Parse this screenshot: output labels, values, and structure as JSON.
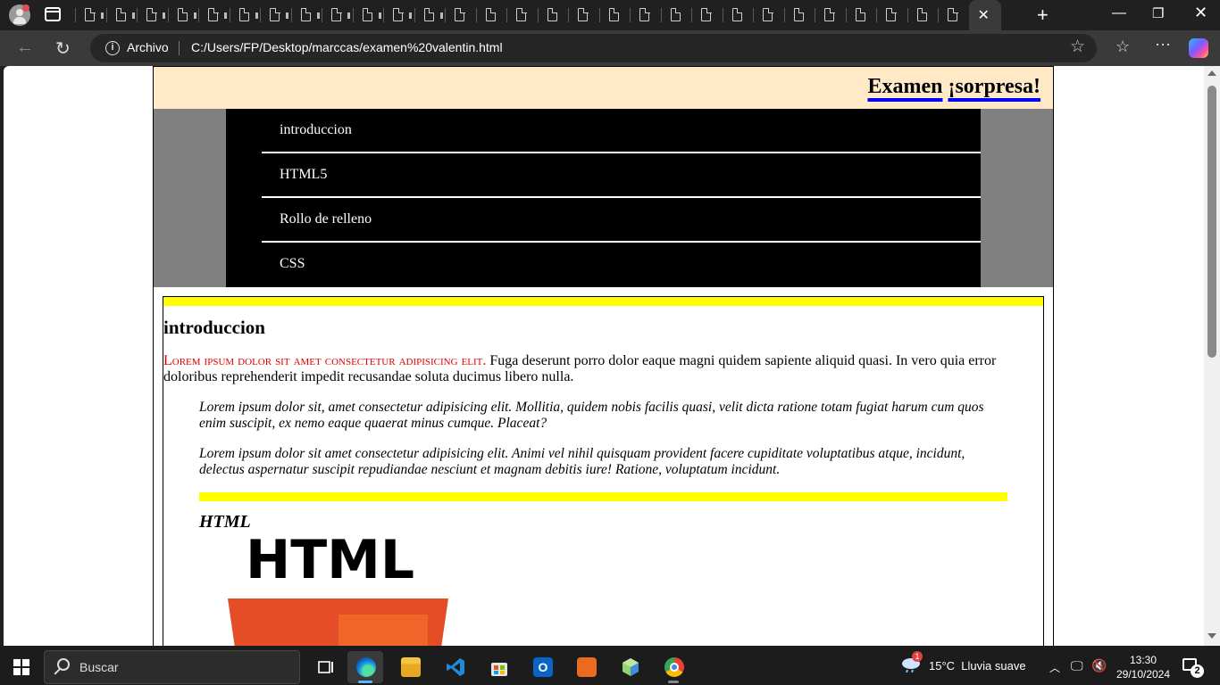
{
  "browser": {
    "tab_count": 30,
    "address": {
      "scheme_label": "Archivo",
      "url": "C:/Users/FP/Desktop/marccas/examen%20valentin.html"
    }
  },
  "page": {
    "title_words": [
      "Examen",
      "¡sorpresa!"
    ],
    "nav_items": [
      {
        "label": "introduccion"
      },
      {
        "label": "HTML5"
      },
      {
        "label": "Rollo de relleno"
      },
      {
        "label": "CSS"
      }
    ],
    "section": {
      "heading": "introduccion",
      "lead_smallcaps": "Lorem ipsum dolor sit amet consectetur adipisicing elit.",
      "lead_text": " Fuga deserunt porro dolor eaque magni quidem sapiente aliquid quasi. In vero quia error doloribus reprehenderit impedit recusandae soluta ducimus libero nulla.",
      "quotes": [
        "Lorem ipsum dolor sit, amet consectetur adipisicing elit. Mollitia, quidem nobis facilis quasi, velit dicta ratione totam fugiat harum cum quos enim suscipit, ex nemo eaque quaerat minus cumque. Placeat?",
        "Lorem ipsum dolor sit amet consectetur adipisicing elit. Animi vel nihil quisquam provident facere cupiditate voluptatibus atque, incidunt, delectus aspernatur suscipit repudiandae nesciunt et magnam debitis iure! Ratione, voluptatum incidunt."
      ],
      "sub_heading": "HTML",
      "logo_text": "HTML"
    },
    "colors": {
      "header_bg": "#ffe9c6",
      "nav_side_bg": "#808080",
      "nav_bg": "#000000",
      "accent_bar": "#ffff00",
      "lead_red": "#e00000",
      "html5_orange": "#e44d26"
    }
  },
  "taskbar": {
    "search_label": "Buscar",
    "weather_temp": "15°C",
    "weather_desc": "Lluvia suave",
    "weather_badge": "1",
    "time": "13:30",
    "date": "29/10/2024",
    "notification_count": "2"
  }
}
